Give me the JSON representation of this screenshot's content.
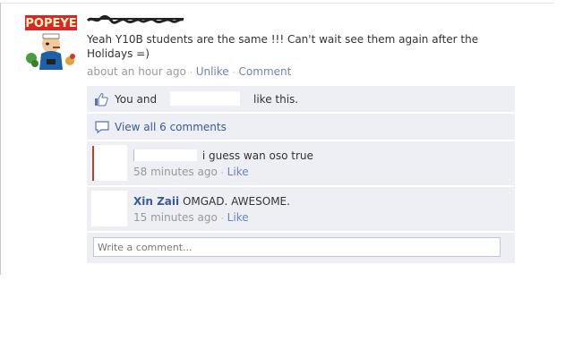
{
  "post": {
    "author_name": "",
    "text": "Yeah Y10B students are the same !!! Can't wait see them again after the Holidays =)",
    "time": "about an hour ago",
    "unlike_label": "Unlike",
    "comment_label": "Comment",
    "avatar_text": "POPEYE"
  },
  "likes": {
    "prefix": "You and",
    "suffix": "like this."
  },
  "view_all": "View all 6 comments",
  "comments": [
    {
      "name": "",
      "text": "i guess wan oso true",
      "time": "58 minutes ago",
      "like": "Like"
    },
    {
      "name": "Xin Zaii",
      "text": "OMGAD. AWESOME.",
      "time": "15 minutes ago",
      "like": "Like"
    }
  ],
  "write_comment": {
    "placeholder": "Write a comment..."
  },
  "colors": {
    "link": "#3b5998",
    "meta_link": "#6d84b4",
    "ufi_bg": "#edeff4"
  }
}
